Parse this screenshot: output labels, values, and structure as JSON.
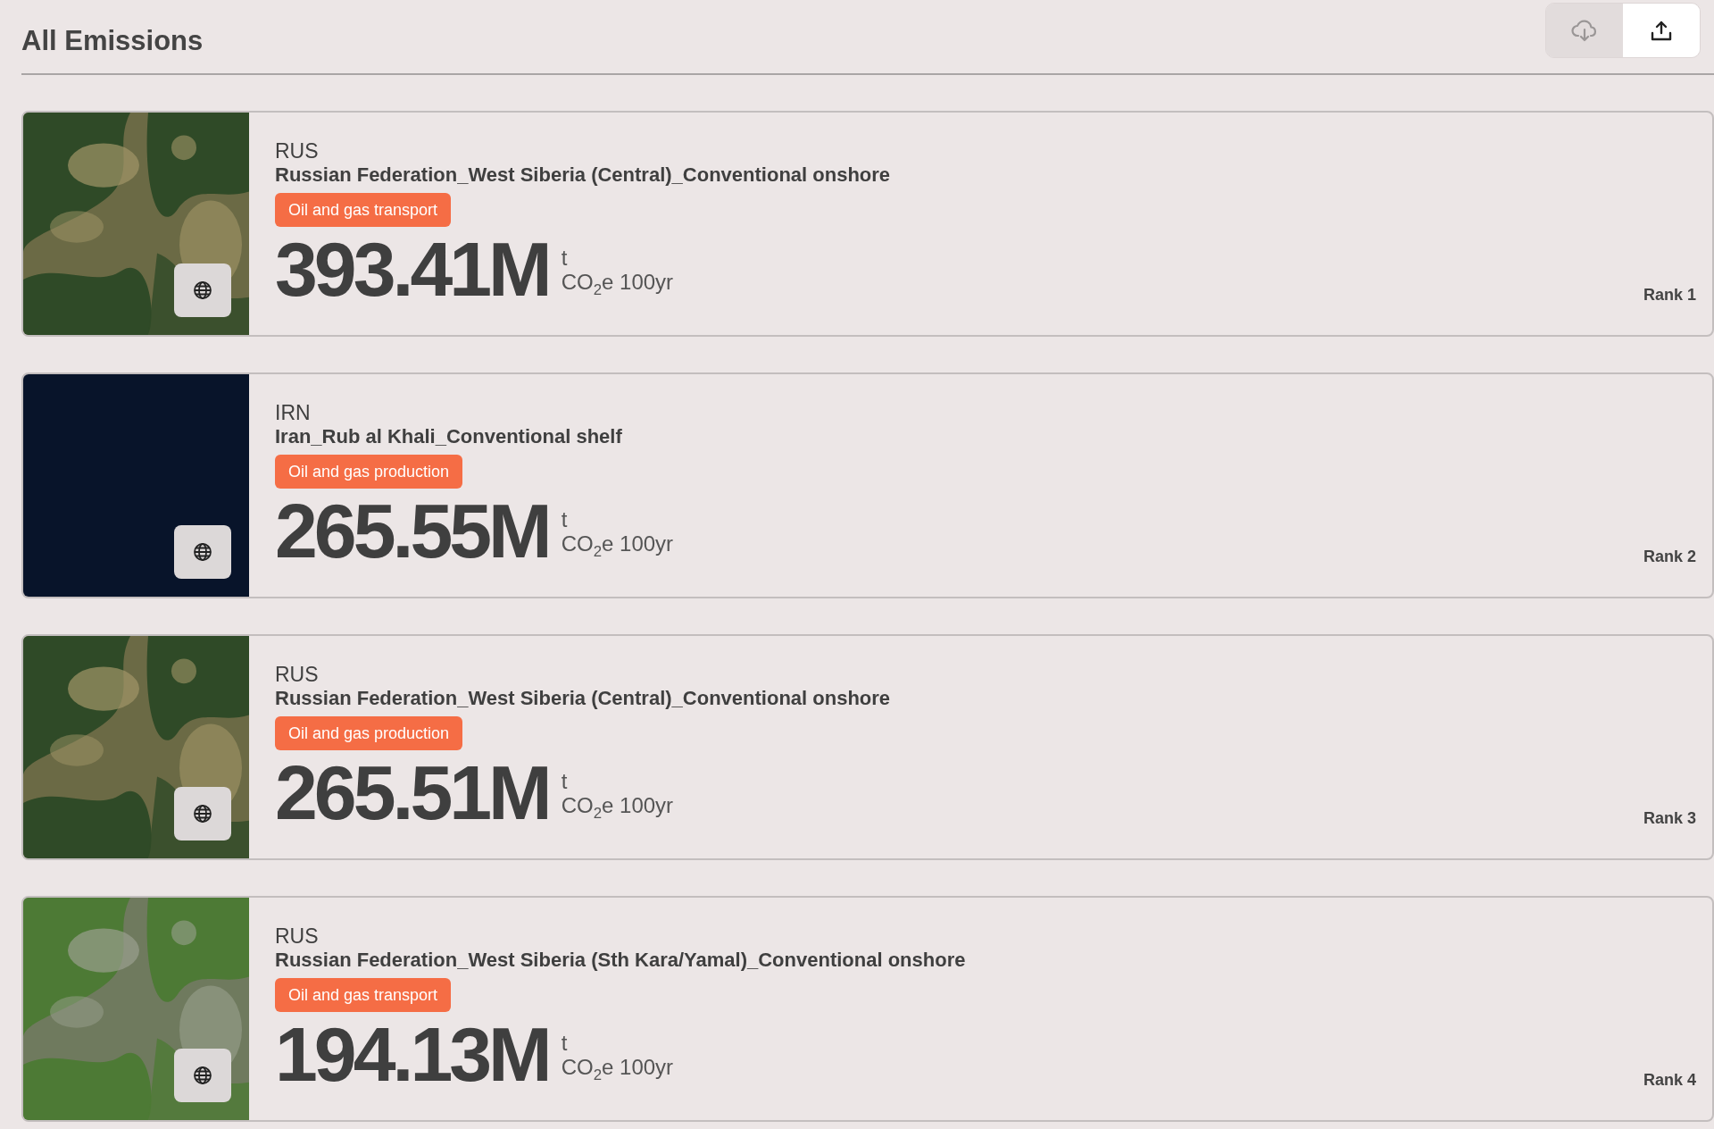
{
  "header": {
    "title": "All Emissions"
  },
  "toolbar": [
    {
      "kind": "download",
      "disabled": true
    },
    {
      "kind": "upload",
      "disabled": false
    }
  ],
  "cards": [
    {
      "country": "RUS",
      "name": "Russian Federation_West Siberia (Central)_Conventional onshore",
      "sector": "Oil and gas transport",
      "value": "393.41M",
      "unit": "t",
      "metric": "CO$_{2}$e 100yr",
      "rank": "Rank 1"
    },
    {
      "image": {
        "kind": "empty"
      },
      "country": "IRN",
      "name": "Iran_Rub al Khali_Conventional shelf",
      "sector": "Oil and gas production",
      "value": "265.55M",
      "unit": "t",
      "metric": "CO$_{2}$e 100yr",
      "rank": "Rank 2"
    },
    {
      "country": "RUS",
      "name": "Russian Federation_West Siberia (Central)_Conventional onshore",
      "sector": "Oil and gas production",
      "value": "265.51M",
      "unit": "t",
      "metric": "CO$_{2}$e 100yr",
      "rank": "Rank 3"
    },
    {
      "country": "RUS",
      "name": "Russian Federation_West Siberia (Sth Kara/Yamal)_Conventional onshore",
      "sector": "Oil and gas transport",
      "value": "194.13M",
      "unit": "t",
      "metric": "CO$_{2}$e 100yr",
      "rank": "Rank 4"
    }
  ]
}
